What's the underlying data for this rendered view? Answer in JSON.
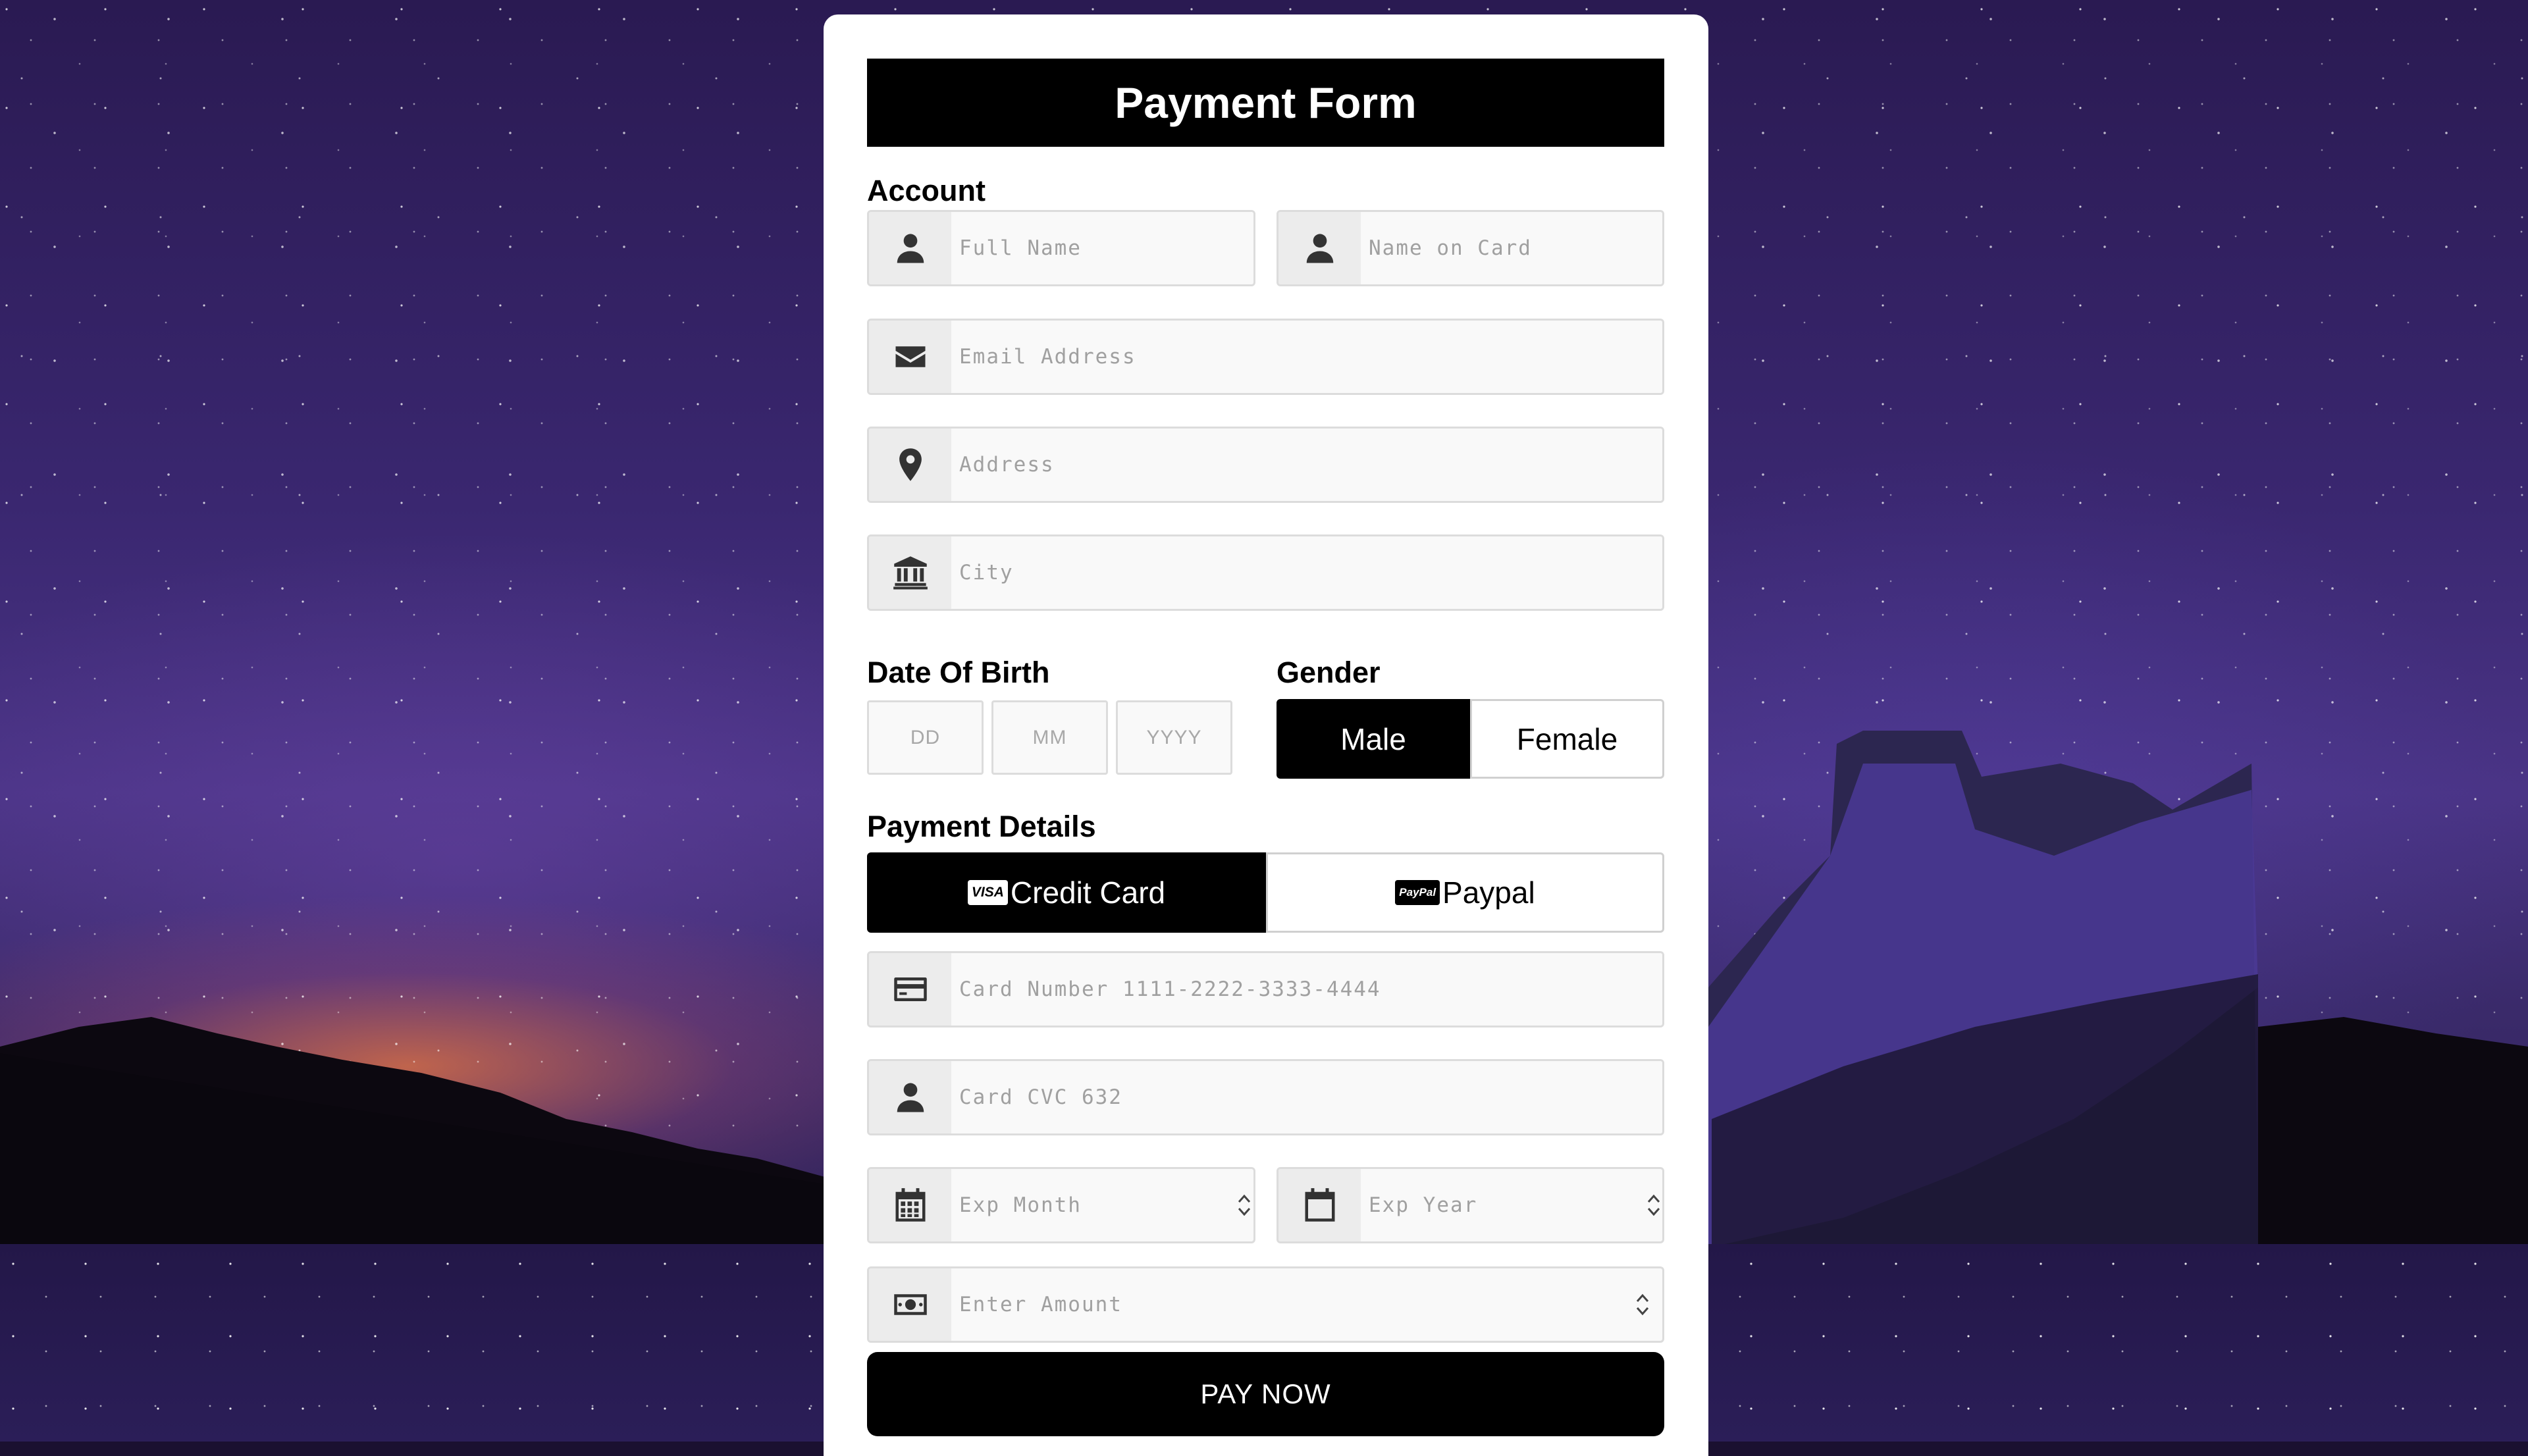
{
  "form": {
    "title": "Payment Form",
    "account_label": "Account",
    "full_name_placeholder": "Full Name",
    "name_on_card_placeholder": "Name on Card",
    "email_placeholder": "Email Address",
    "address_placeholder": "Address",
    "city_placeholder": "City",
    "dob_label": "Date Of Birth",
    "dob_day": "DD",
    "dob_month": "MM",
    "dob_year": "YYYY",
    "gender_label": "Gender",
    "gender_male": "Male",
    "gender_female": "Female",
    "gender_selected": "Male",
    "payment_label": "Payment Details",
    "method_credit": "Credit Card",
    "method_credit_badge": "VISA",
    "method_paypal": "Paypal",
    "method_paypal_badge": "PayPal",
    "method_selected": "Credit Card",
    "card_number_placeholder": "Card Number 1111-2222-3333-4444",
    "card_cvc_placeholder": "Card CVC 632",
    "exp_month_placeholder": "Exp Month",
    "exp_year_placeholder": "Exp Year",
    "amount_placeholder": "Enter Amount",
    "submit_label": "PAY NOW"
  },
  "colors": {
    "accent": "#000000",
    "field_bg": "#f9f9f9",
    "icon_bg": "#ececec"
  },
  "icons": {
    "full_name": "user-icon",
    "name_on_card": "user-icon",
    "email": "envelope-icon",
    "address": "map-pin-icon",
    "city": "bank-icon",
    "card_number": "credit-card-icon",
    "card_cvc": "user-icon",
    "exp_month": "calendar-grid-icon",
    "exp_year": "calendar-icon",
    "amount": "money-bill-icon"
  }
}
